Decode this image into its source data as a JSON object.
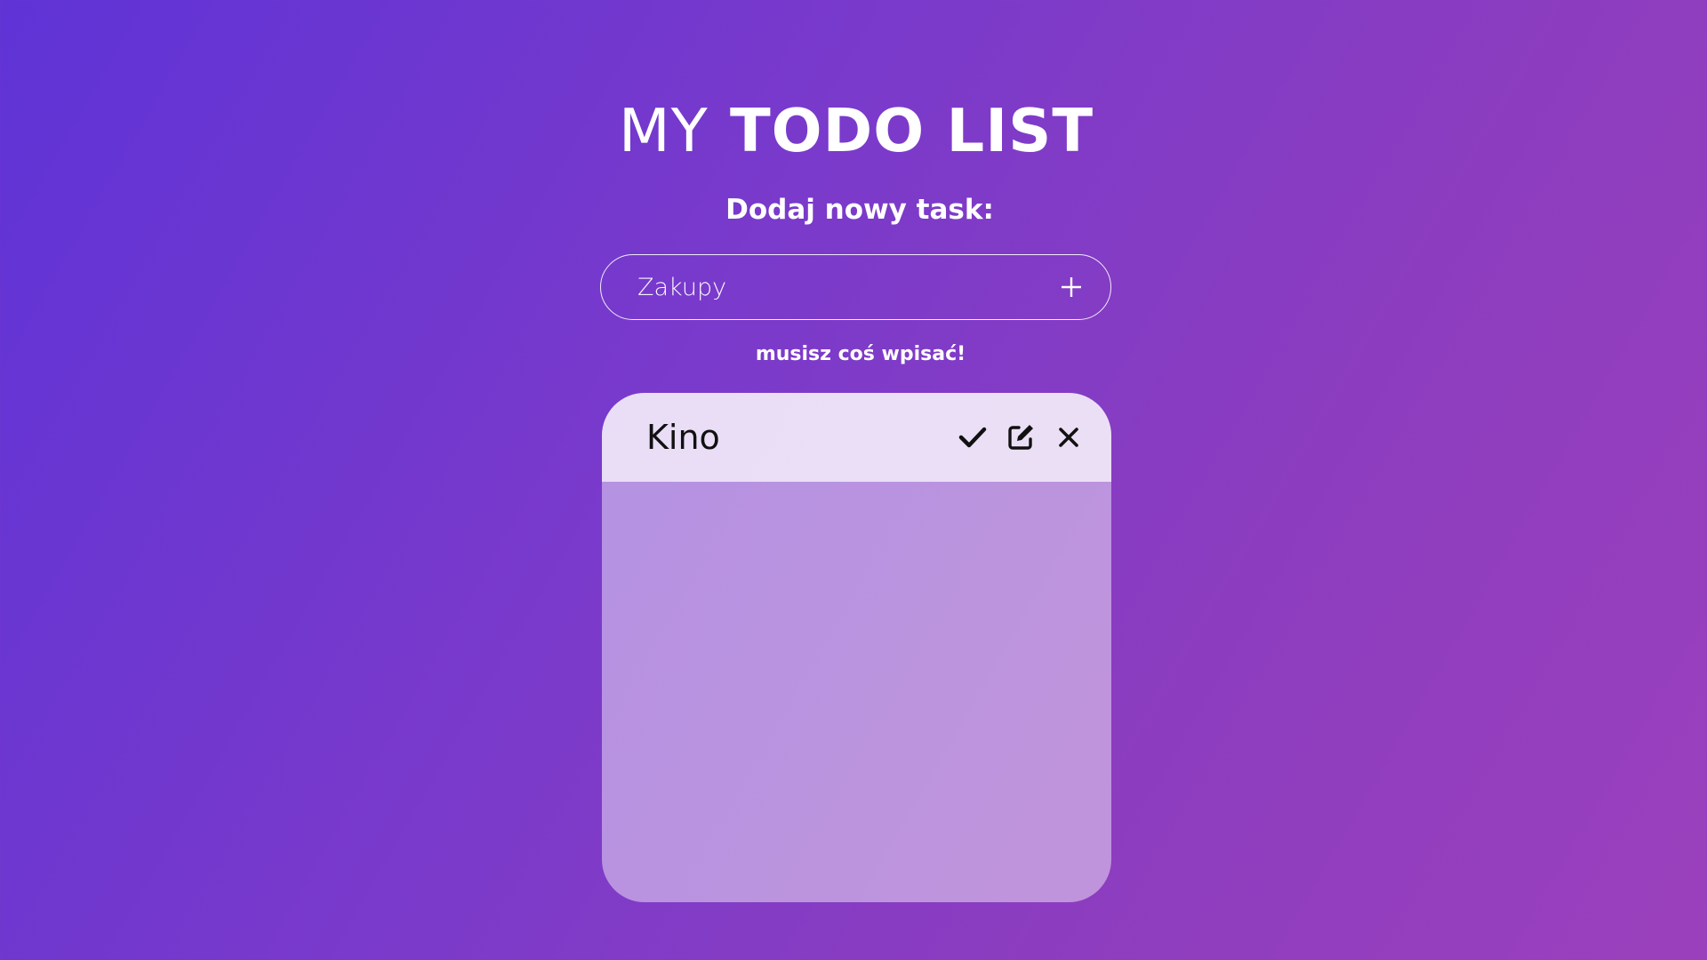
{
  "header": {
    "title_light": "MY",
    "title_bold": "TODO LIST",
    "subtitle": "Dodaj nowy task:"
  },
  "new_task": {
    "value": "",
    "placeholder": "Zakupy",
    "add_icon": "plus-icon"
  },
  "validation": {
    "error_text": "musisz coś wpisać!"
  },
  "tasks": [
    {
      "label": "Kino",
      "actions": [
        "check-icon",
        "edit-icon",
        "close-icon"
      ]
    }
  ],
  "colors": {
    "background_start": "#5f33d6",
    "background_end": "#9b40bd",
    "text": "#ffffff",
    "task_text": "#111111"
  }
}
